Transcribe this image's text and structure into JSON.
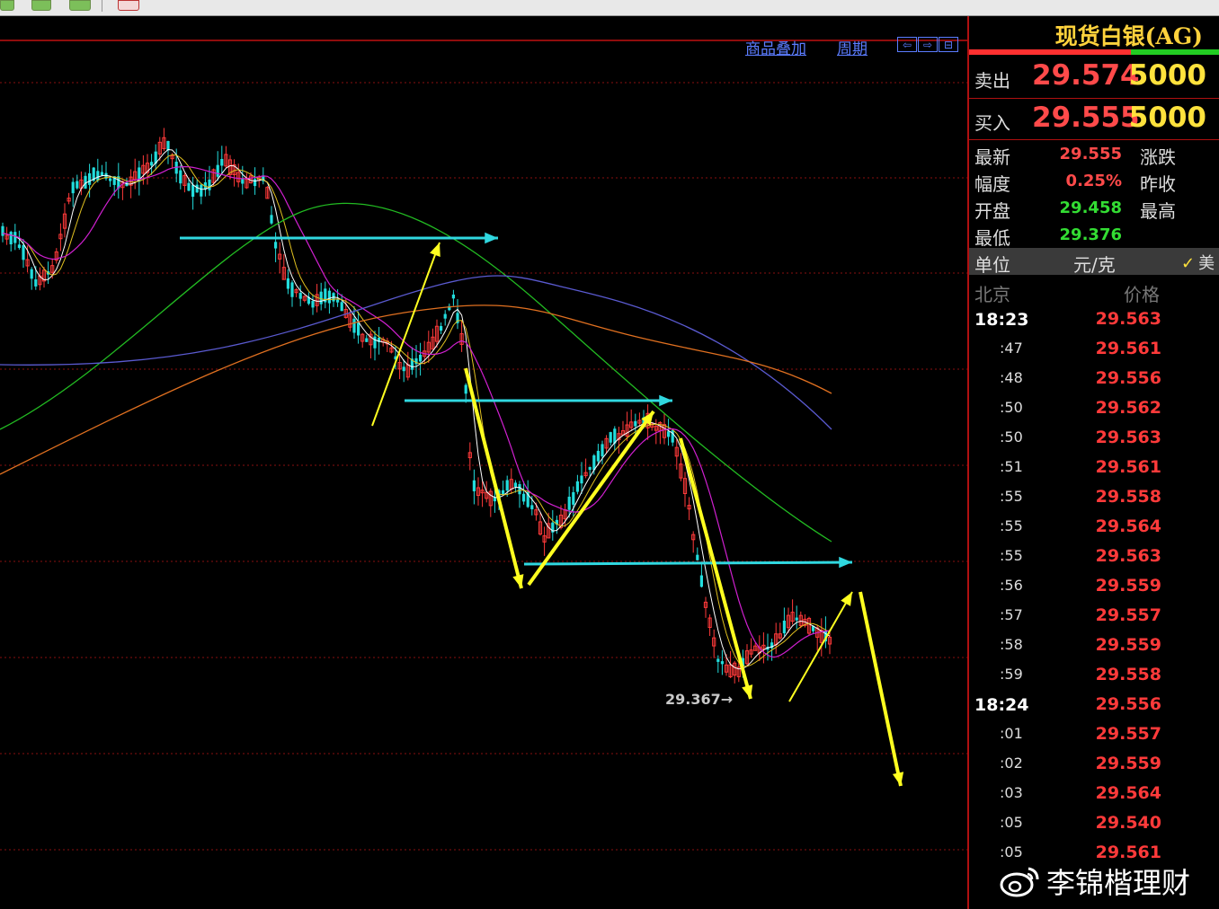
{
  "toolbar": {
    "buttons": [
      "",
      "",
      ""
    ]
  },
  "chart": {
    "links": {
      "overlay": "商品叠加",
      "period": "周期"
    },
    "nav": {
      "left": "⇦",
      "right": "⇨",
      "split": "⊟"
    },
    "low_label": "29.367→"
  },
  "panel": {
    "title": "现货白银(AG)",
    "sell": {
      "label": "卖出",
      "price": "29.574",
      "volume": "5000"
    },
    "buy": {
      "label": "买入",
      "price": "29.555",
      "volume": "5000"
    },
    "quote": [
      {
        "label": "最新",
        "value": "29.555",
        "color": "#ff4a4a",
        "label2": "涨跌"
      },
      {
        "label": "幅度",
        "value": "0.25%",
        "color": "#ff4a4a",
        "label2": "昨收"
      },
      {
        "label": "开盘",
        "value": "29.458",
        "color": "#33dd33",
        "label2": "最高"
      },
      {
        "label": "最低",
        "value": "29.376",
        "color": "#33dd33",
        "label2": ""
      }
    ],
    "unit": {
      "label": "单位",
      "value": "元/克",
      "check": "✓",
      "currency": "美"
    },
    "table_head": {
      "time": "北京",
      "price": "价格"
    },
    "ticks": [
      {
        "time": "18:23",
        "price": "29.563",
        "major": true
      },
      {
        "time": ":47",
        "price": "29.561"
      },
      {
        "time": ":48",
        "price": "29.556"
      },
      {
        "time": ":50",
        "price": "29.562"
      },
      {
        "time": ":50",
        "price": "29.563"
      },
      {
        "time": ":51",
        "price": "29.561"
      },
      {
        "time": ":55",
        "price": "29.558"
      },
      {
        "time": ":55",
        "price": "29.564"
      },
      {
        "time": ":55",
        "price": "29.563"
      },
      {
        "time": ":56",
        "price": "29.559"
      },
      {
        "time": ":57",
        "price": "29.557"
      },
      {
        "time": ":58",
        "price": "29.559"
      },
      {
        "time": ":59",
        "price": "29.558"
      },
      {
        "time": "18:24",
        "price": "29.556",
        "major": true
      },
      {
        "time": ":01",
        "price": "29.557"
      },
      {
        "time": ":02",
        "price": "29.559"
      },
      {
        "time": ":03",
        "price": "29.564"
      },
      {
        "time": ":05",
        "price": "29.540"
      },
      {
        "time": ":05",
        "price": "29.561"
      }
    ]
  },
  "watermark": {
    "text": "李锦楷理财"
  },
  "colors": {
    "up": "#ff3a3a",
    "down": "#22dddd",
    "accent": "#ffe23c",
    "grid": "#8a1010"
  }
}
